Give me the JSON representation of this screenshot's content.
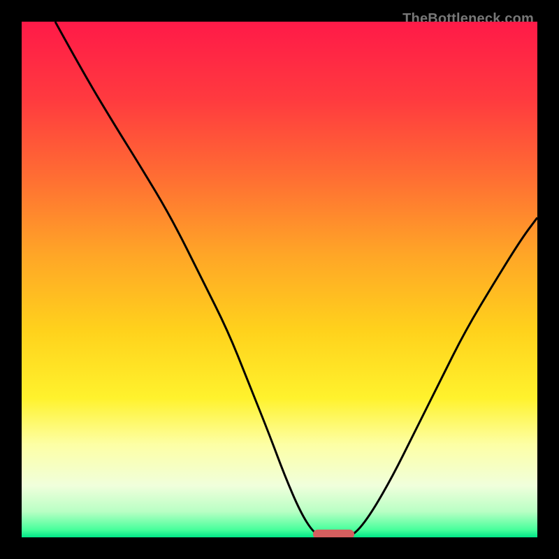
{
  "watermark": "TheBottleneck.com",
  "chart_data": {
    "type": "line",
    "title": "",
    "xlabel": "",
    "ylabel": "",
    "xlim": [
      0,
      100
    ],
    "ylim": [
      0,
      100
    ],
    "axes_visible": false,
    "grid": false,
    "background_gradient_stops": [
      {
        "pos": 0.0,
        "color": "#ff1a48"
      },
      {
        "pos": 0.15,
        "color": "#ff3a3f"
      },
      {
        "pos": 0.3,
        "color": "#ff6d33"
      },
      {
        "pos": 0.45,
        "color": "#ffa527"
      },
      {
        "pos": 0.6,
        "color": "#ffd21c"
      },
      {
        "pos": 0.73,
        "color": "#fff22d"
      },
      {
        "pos": 0.82,
        "color": "#fdffa5"
      },
      {
        "pos": 0.9,
        "color": "#f0ffdc"
      },
      {
        "pos": 0.95,
        "color": "#b9ffc4"
      },
      {
        "pos": 0.985,
        "color": "#48ff9c"
      },
      {
        "pos": 1.0,
        "color": "#00e688"
      }
    ],
    "series": [
      {
        "name": "bottleneck-curve",
        "stroke": "#000000",
        "stroke_width": 3,
        "points": [
          {
            "x": 6.5,
            "y": 100
          },
          {
            "x": 12,
            "y": 90
          },
          {
            "x": 18,
            "y": 80
          },
          {
            "x": 23,
            "y": 72
          },
          {
            "x": 29,
            "y": 62
          },
          {
            "x": 35,
            "y": 50
          },
          {
            "x": 40,
            "y": 40
          },
          {
            "x": 44,
            "y": 30
          },
          {
            "x": 48,
            "y": 20
          },
          {
            "x": 51,
            "y": 12
          },
          {
            "x": 54,
            "y": 5
          },
          {
            "x": 56.5,
            "y": 1
          },
          {
            "x": 58.5,
            "y": 0
          },
          {
            "x": 63,
            "y": 0
          },
          {
            "x": 65,
            "y": 1
          },
          {
            "x": 68,
            "y": 5
          },
          {
            "x": 72,
            "y": 12
          },
          {
            "x": 76,
            "y": 20
          },
          {
            "x": 81,
            "y": 30
          },
          {
            "x": 86,
            "y": 40
          },
          {
            "x": 92,
            "y": 50
          },
          {
            "x": 97,
            "y": 58
          },
          {
            "x": 100,
            "y": 62
          }
        ]
      }
    ],
    "marker": {
      "name": "optimal-range",
      "shape": "rounded-rect",
      "fill": "#d55f5f",
      "x_center": 60.5,
      "y_center": 0.6,
      "width": 8.0,
      "height": 1.8,
      "rx": 0.9
    }
  }
}
